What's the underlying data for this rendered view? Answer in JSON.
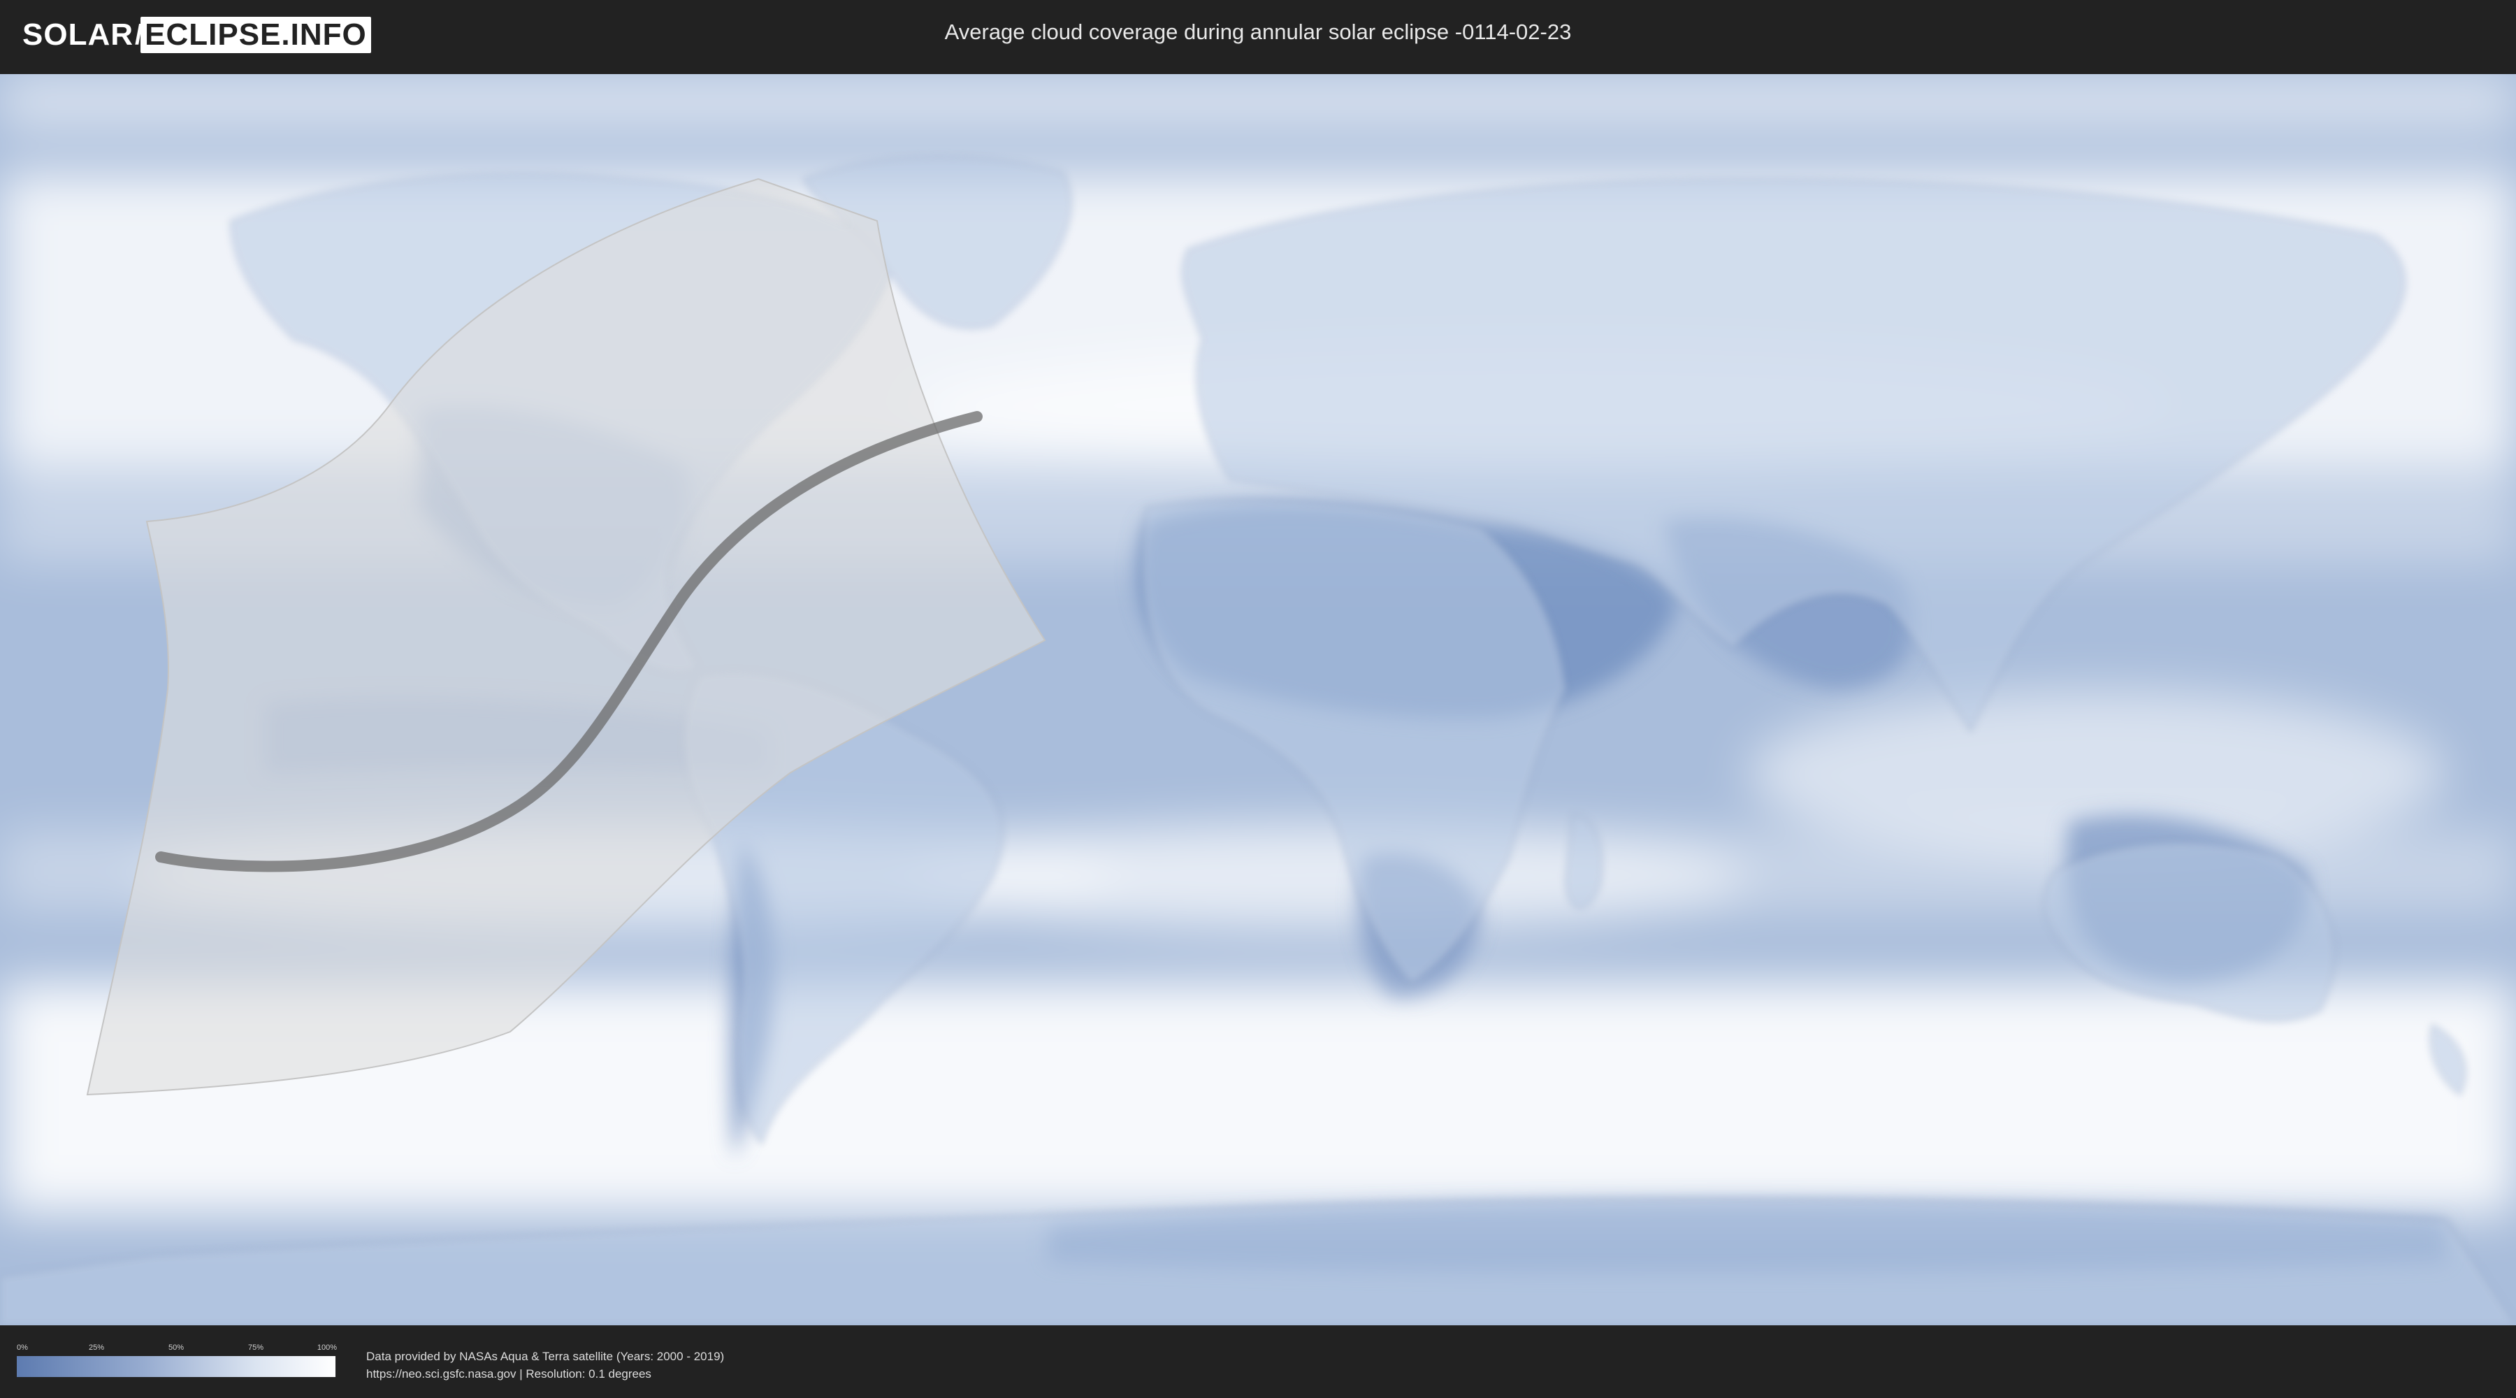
{
  "header": {
    "logo": {
      "part1": "SOLAR",
      "part2": "ECLIPSE.INFO"
    },
    "title": "Average cloud coverage during annular solar eclipse -0114-02-23"
  },
  "map": {
    "projection": "equirectangular world map",
    "base_color": "#9fb4d3",
    "cloud_color": "#ffffff",
    "eclipse_shading_color": "#dcdcdc",
    "central_line_color": "#6b6b6b"
  },
  "legend": {
    "ticks": [
      "0%",
      "25%",
      "50%",
      "75%",
      "100%"
    ],
    "colors": [
      "#5d7bb0",
      "#97acd0",
      "#dbe4f1",
      "#ffffff"
    ]
  },
  "footer": {
    "source_line1": "Data provided by NASAs Aqua & Terra satellite (Years: 2000 - 2019)",
    "source_line2": "https://neo.sci.gsfc.nasa.gov | Resolution: 0.1 degrees"
  }
}
